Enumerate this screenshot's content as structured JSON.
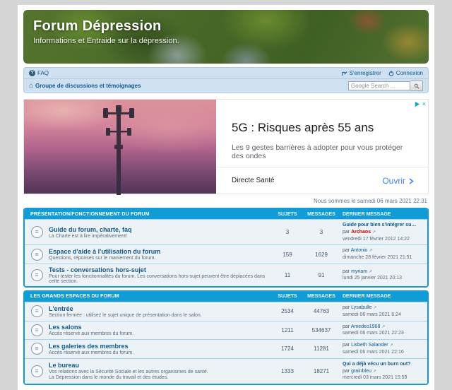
{
  "header": {
    "title": "Forum Dépression",
    "subtitle": "Informations et Entraide sur la dépression."
  },
  "nav": {
    "faq": "FAQ",
    "register": "S'enregistrer",
    "login": "Connexion",
    "breadcrumb": "Groupe de discussions et témoignages",
    "search_placeholder": "Google Search ..."
  },
  "icons": {
    "faq_glyph": "?",
    "home_glyph": "⌂",
    "forum_glyph": "≡",
    "lastpost_glyph": "↗",
    "close_glyph": "×"
  },
  "ad": {
    "headline": "5G : Risques après 55 ans",
    "subline": "Les 9 gestes barrières à adopter pour vous protéger des ondes",
    "advertiser": "Directe Santé",
    "cta": "Ouvrir"
  },
  "statusline": "Nous sommes le samedi 06 mars 2021 22:31",
  "labels": {
    "by": "par",
    "topics": "SUJETS",
    "messages": "MESSAGES",
    "last_message": "DERNIER MESSAGE"
  },
  "colors": {
    "section_blue": "#119bd7",
    "link_blue": "#0f5a8d",
    "admin_red": "#bf0000",
    "ad_cta_blue": "#4285f4"
  },
  "sections": [
    {
      "title": "PRÉSENTATION/FONCTIONNEMENT DU FORUM",
      "rows": [
        {
          "title": "Guide du forum, charte, faq",
          "desc": "La Charte est à lire impérativement!",
          "topics": "3",
          "posts": "3",
          "last_topic": "Guide pour bien s'intégrer su…",
          "last_user": "Archaos",
          "user_style": "color:#bf0000;font-weight:bold",
          "last_date": "vendredi 17 février 2012 14:22"
        },
        {
          "title": "Espace d'aide à l'utilisation du forum",
          "desc": "Questions, réponses sur le maniement du forum.",
          "topics": "159",
          "posts": "1629",
          "last_user": "Antonio",
          "last_date": "dimanche 28 février 2021 21:51"
        },
        {
          "title": "Tests - conversations hors-sujet",
          "desc": "Pour tester les fonctionnalités du forum. Les conversations hors-sujet peuvent être déplacées dans cette section.",
          "topics": "11",
          "posts": "91",
          "last_user": "myriam",
          "last_date": "lundi 25 janvier 2021 20:13"
        }
      ]
    },
    {
      "title": "LES GRANDS ESPACES DU FORUM",
      "rows": [
        {
          "title": "L'entrée",
          "desc": "Section fermée : utilisez le sujet unique de présentation dans le salon.",
          "topics": "2534",
          "posts": "44763",
          "last_user": "Lysabulle",
          "last_date": "samedi 06 mars 2021 6:24"
        },
        {
          "title": "Les salons",
          "desc": "Accès réservé aux membres du forum.",
          "topics": "1211",
          "posts": "534637",
          "last_user": "Amedeo1968",
          "last_date": "samedi 06 mars 2021 22:23"
        },
        {
          "title": "Les galeries des membres",
          "desc": "Accès réservé aux membres du forum.",
          "topics": "1724",
          "posts": "11281",
          "last_user": "Lisbeth Salander",
          "last_date": "samedi 06 mars 2021 22:16"
        },
        {
          "title": "Le bureau",
          "desc": "Vos relations avec la Sécurité Sociale et les autres organismes de santé.",
          "desc2": "La Dépression dans le monde du travail et des études.",
          "topics": "1333",
          "posts": "18271",
          "last_topic": "Qui a déjà vécu un burn out?",
          "last_user": "grainbleu",
          "last_date": "mercredi 03 mars 2021 15:59"
        }
      ]
    }
  ]
}
